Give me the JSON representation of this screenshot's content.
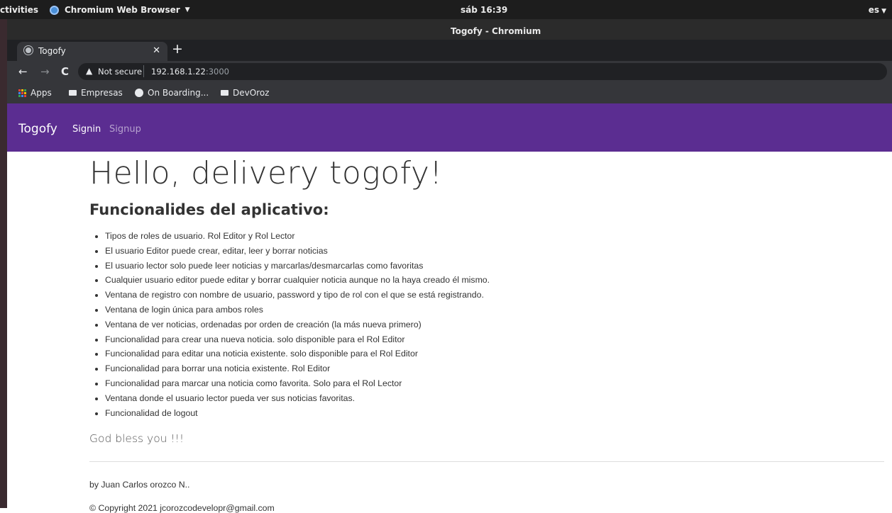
{
  "system_bar": {
    "activities": "ctivities",
    "app_name": "Chromium Web Browser",
    "clock": "sáb 16:39",
    "language": "es"
  },
  "window": {
    "title": "Togofy - Chromium"
  },
  "tabs": [
    {
      "title": "Togofy"
    }
  ],
  "address": {
    "security_label": "Not secure",
    "host": "192.168.1.22",
    "port": ":3000"
  },
  "bookmarks": [
    {
      "label": "Apps",
      "icon": "apps-grid-icon"
    },
    {
      "label": "Empresas",
      "icon": "folder-icon"
    },
    {
      "label": "On Boarding...",
      "icon": "globe-icon"
    },
    {
      "label": "DevOroz",
      "icon": "folder-icon"
    }
  ],
  "navbar": {
    "brand": "Togofy",
    "links": [
      {
        "label": "Signin"
      },
      {
        "label": "Signup"
      }
    ],
    "background": "#5b2d91"
  },
  "main": {
    "heading": "Hello, delivery togofy!",
    "subheading": "Funcionalides del aplicativo:",
    "features": [
      "Tipos de roles de usuario. Rol Editor y Rol Lector",
      "El usuario Editor puede crear, editar, leer y borrar noticias",
      "El usuario lector solo puede leer noticias y marcarlas/desmarcarlas como favoritas",
      "Cualquier usuario editor puede editar y borrar cualquier noticia aunque no la haya creado él mismo.",
      "Ventana de registro con nombre de usuario, password y tipo de rol con el que se está registrando.",
      "Ventana de login única para ambos roles",
      "Ventana de ver noticias, ordenadas por orden de creación (la más nueva primero)",
      "Funcionalidad para crear una nueva noticia. solo disponible para el Rol Editor",
      "Funcionalidad para editar una noticia existente. solo disponible para el Rol Editor",
      "Funcionalidad para borrar una noticia existente. Rol Editor",
      "Funcionalidad para marcar una noticia como favorita. Solo para el Rol Lector",
      "Ventana donde el usuario lector pueda ver sus noticias favoritas.",
      "Funcionalidad de logout"
    ],
    "closing": "God bless you !!!"
  },
  "footer": {
    "author": "by Juan Carlos orozco N..",
    "copyright": "© Copyright 2021 jcorozcodevelopr@gmail.com"
  }
}
